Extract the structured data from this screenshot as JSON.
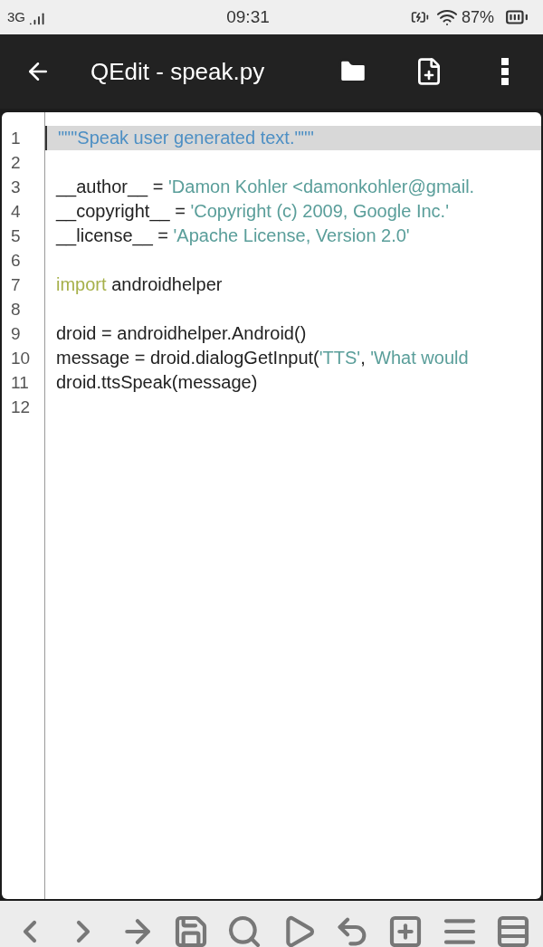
{
  "status_bar": {
    "network": "3G",
    "time": "09:31",
    "battery": "87%"
  },
  "app_bar": {
    "title": "QEdit - speak.py"
  },
  "editor": {
    "lines": [
      {
        "number": "1",
        "current": true,
        "tokens": [
          {
            "kind": "docstring",
            "text": "\"\"\"Speak user generated text.\"\"\""
          }
        ]
      },
      {
        "number": "2",
        "current": false
      },
      {
        "number": "3",
        "current": false,
        "tokens": [
          {
            "kind": "plain",
            "text": "__author__ = "
          },
          {
            "kind": "string",
            "text": "'Damon Kohler <damonkohler@gmail."
          }
        ]
      },
      {
        "number": "4",
        "current": false,
        "tokens": [
          {
            "kind": "plain",
            "text": "__copyright__ = "
          },
          {
            "kind": "string",
            "text": "'Copyright (c) 2009, Google Inc.'"
          }
        ]
      },
      {
        "number": "5",
        "current": false,
        "tokens": [
          {
            "kind": "plain",
            "text": "__license__ = "
          },
          {
            "kind": "string",
            "text": "'Apache License, Version 2.0'"
          }
        ]
      },
      {
        "number": "6",
        "current": false
      },
      {
        "number": "7",
        "current": false,
        "tokens": [
          {
            "kind": "keyword",
            "text": "import"
          },
          {
            "kind": "plain",
            "text": " androidhelper"
          }
        ]
      },
      {
        "number": "8",
        "current": false
      },
      {
        "number": "9",
        "current": false,
        "tokens": [
          {
            "kind": "plain",
            "text": "droid = androidhelper.Android()"
          }
        ]
      },
      {
        "number": "10",
        "current": false,
        "tokens": [
          {
            "kind": "plain",
            "text": "message = droid.dialogGetInput("
          },
          {
            "kind": "string",
            "text": "'TTS'"
          },
          {
            "kind": "plain",
            "text": ", "
          },
          {
            "kind": "string",
            "text": "'What would"
          }
        ]
      },
      {
        "number": "11",
        "current": false,
        "tokens": [
          {
            "kind": "plain",
            "text": "droid.ttsSpeak(message)"
          }
        ]
      },
      {
        "number": "12",
        "current": false
      }
    ]
  }
}
